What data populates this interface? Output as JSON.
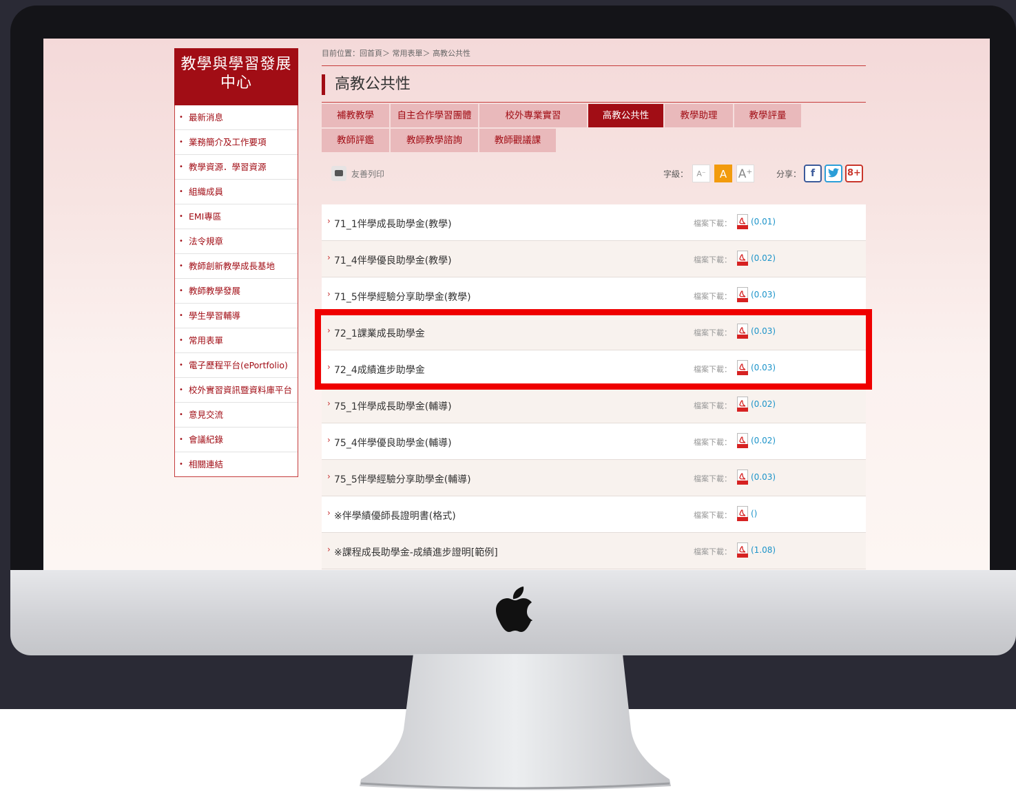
{
  "site": {
    "name": "教學與學習發展中心"
  },
  "breadcrumb": "目前位置：回首頁＞ 常用表單＞ 高教公共性",
  "page_title": "高教公共性",
  "sidebar": {
    "items": [
      {
        "label": "最新消息"
      },
      {
        "label": "業務簡介及工作要項"
      },
      {
        "label": "教學資源．學習資源"
      },
      {
        "label": "組織成員"
      },
      {
        "label": "EMI專區"
      },
      {
        "label": "法令規章"
      },
      {
        "label": "教師創新教學成長基地"
      },
      {
        "label": "教師教學發展"
      },
      {
        "label": "學生學習輔導"
      },
      {
        "label": "常用表單"
      },
      {
        "label": "電子歷程平台(ePortfolio)"
      },
      {
        "label": "校外實習資訊暨資料庫平台"
      },
      {
        "label": "意見交流"
      },
      {
        "label": "會議紀錄"
      },
      {
        "label": "相關連結"
      }
    ]
  },
  "tabs": [
    {
      "label": "補教教學"
    },
    {
      "label": "自主合作學習團體"
    },
    {
      "label": "校外專業實習"
    },
    {
      "label": "高教公共性"
    },
    {
      "label": "教學助理"
    },
    {
      "label": "教學評量"
    },
    {
      "label": "教師評鑑"
    },
    {
      "label": "教師教學諮詢"
    },
    {
      "label": "教師觀議課"
    }
  ],
  "toolbar": {
    "print_label": "友善列印",
    "font_label": "字級：",
    "font_small": "A⁻",
    "font_mid": "A",
    "font_large": "A⁺",
    "share_label": "分享："
  },
  "files": [
    {
      "name": "71_1伴學成長助學金(教學)",
      "dl_label": "檔案下載：",
      "count": "(0.01)"
    },
    {
      "name": "71_4伴學優良助學金(教學)",
      "dl_label": "檔案下載：",
      "count": "(0.02)"
    },
    {
      "name": "71_5伴學經驗分享助學金(教學)",
      "dl_label": "檔案下載：",
      "count": "(0.03)"
    },
    {
      "name": "72_1課業成長助學金",
      "dl_label": "檔案下載：",
      "count": "(0.03)"
    },
    {
      "name": "72_4成績進步助學金",
      "dl_label": "檔案下載：",
      "count": "(0.03)"
    },
    {
      "name": "75_1伴學成長助學金(輔導)",
      "dl_label": "檔案下載：",
      "count": "(0.02)"
    },
    {
      "name": "75_4伴學優良助學金(輔導)",
      "dl_label": "檔案下載：",
      "count": "(0.02)"
    },
    {
      "name": "75_5伴學經驗分享助學金(輔導)",
      "dl_label": "檔案下載：",
      "count": "(0.03)"
    },
    {
      "name": "※伴學績優師長證明書(格式)",
      "dl_label": "檔案下載：",
      "count": "()"
    },
    {
      "name": "※課程成長助學金-成績進步證明[範例]",
      "dl_label": "檔案下載：",
      "count": "(1.08)"
    }
  ],
  "colors": {
    "brand": "#a10d15",
    "tab": "#e9b9bb",
    "highlight": "#ef0000",
    "link": "#1b93c9"
  }
}
